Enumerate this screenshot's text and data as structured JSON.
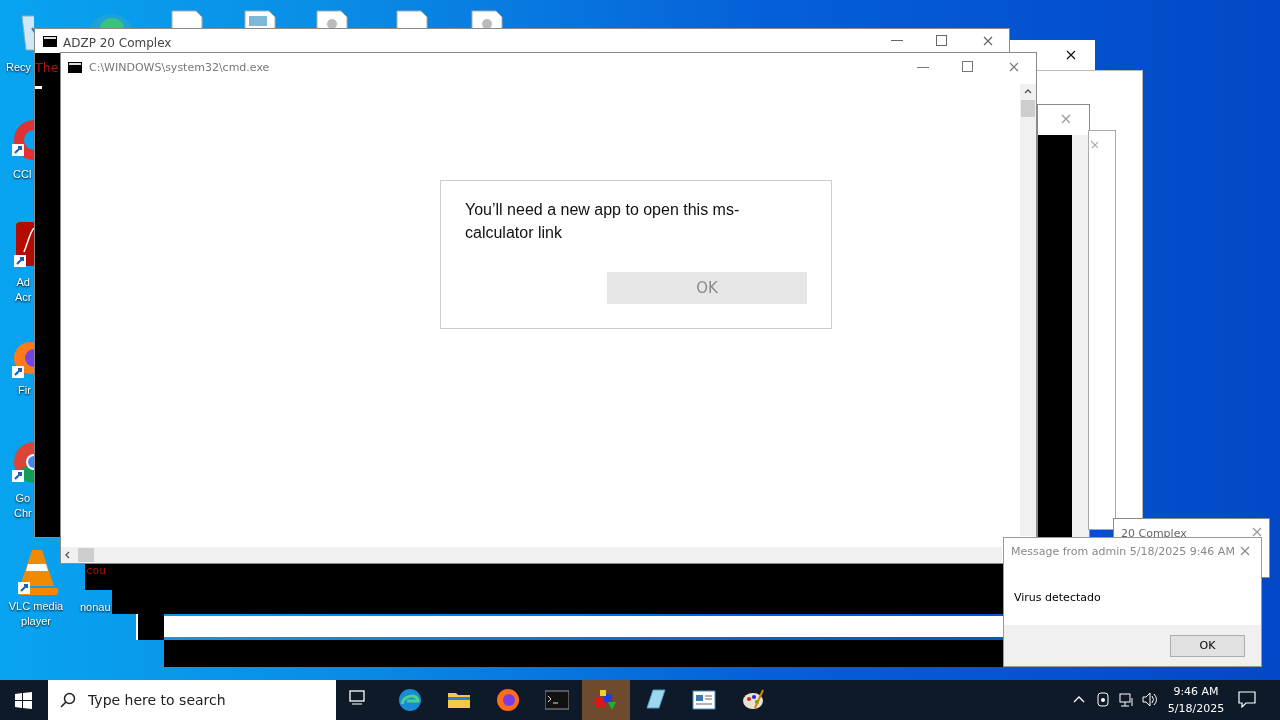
{
  "desktop_icons": [
    {
      "kind": "recycle",
      "lines": [
        "Recy"
      ]
    },
    {
      "kind": "ccleaner",
      "lines": [
        "CCl"
      ]
    },
    {
      "kind": "acrobat",
      "lines": [
        "Ad",
        "Acr"
      ]
    },
    {
      "kind": "firefox",
      "lines": [
        "Fir"
      ]
    },
    {
      "kind": "chrome",
      "lines": [
        "Go",
        "Chr"
      ]
    },
    {
      "kind": "vlc",
      "lines": [
        "VLC media",
        "player"
      ]
    },
    {
      "kind": "console",
      "lines": [
        "nonau"
      ]
    }
  ],
  "windows": [
    {
      "title": "ADZP 20 Complex",
      "console_text": "The"
    },
    {
      "title": "C:\\WINDOWS\\system32\\cmd.exe"
    },
    {
      "title": "20 Complex"
    }
  ],
  "small_console": {
    "console_text": "cou"
  },
  "dialog": {
    "text": "You’ll need a new app to open this ms-calculator link",
    "button": "OK",
    "disabled": true
  },
  "message": {
    "title": "Message from admin 5/18/2025 9:46 AM",
    "text": "Virus detectado",
    "button": "OK"
  },
  "taskbar": {
    "search_placeholder": "Type here to search",
    "apps": [
      {
        "kind": "taskview",
        "active": false
      },
      {
        "kind": "edge",
        "active": false
      },
      {
        "kind": "explorer",
        "active": false
      },
      {
        "kind": "firefox",
        "active": false
      },
      {
        "kind": "cmd",
        "active": false
      },
      {
        "kind": "shapes",
        "active": true
      },
      {
        "kind": "notebook",
        "active": false
      },
      {
        "kind": "news",
        "active": false
      },
      {
        "kind": "paint",
        "active": false
      }
    ],
    "time": "9:46 AM",
    "date": "5/18/2025"
  }
}
